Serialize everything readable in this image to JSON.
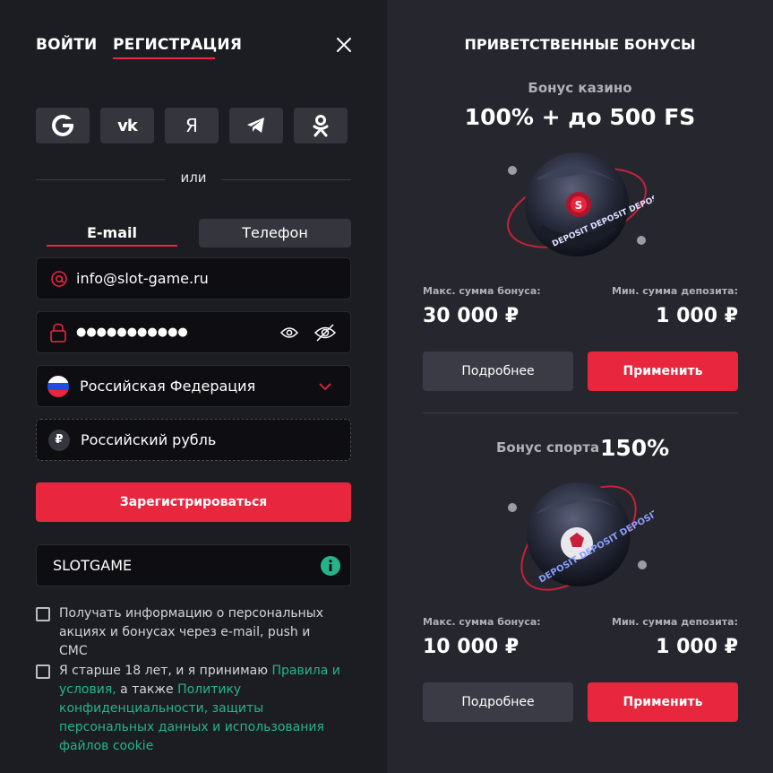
{
  "auth": {
    "tab_login": "ВОЙТИ",
    "tab_register": "РЕГИСТРАЦИЯ",
    "social": [
      {
        "name": "google",
        "glyph": "G"
      },
      {
        "name": "vk",
        "glyph": "vk"
      },
      {
        "name": "yandex",
        "glyph": "Я"
      },
      {
        "name": "telegram",
        "glyph": ""
      },
      {
        "name": "odnoklassniki",
        "glyph": ""
      }
    ],
    "or_text": "или",
    "method_email": "E-mail",
    "method_phone": "Телефон",
    "email_value": "info@slot-game.ru",
    "password_value": "●●●●●●●●●●●",
    "country_value": "Российская Федерация",
    "currency_value": "Российский рубль",
    "register_button": "Зарегистрироваться",
    "promo_value": "SLOTGAME",
    "consent_marketing": "Получать информацию о персональных акциях и бонусах через e-mail, push и СМС",
    "consent_age_prefix": "Я старше 18 лет, и я принимаю ",
    "consent_age_link1": "Правила и условия,",
    "consent_age_mid": " а также ",
    "consent_age_link2": "Политику конфиденциальности, защиты персональных данных и использования файлов cookie"
  },
  "bonuses": {
    "title": "ПРИВЕТСТВЕННЫЕ БОНУСЫ",
    "casino": {
      "label": "Бонус казино",
      "value": "100% + до 500 FS",
      "max_label": "Макс. сумма бонуса:",
      "max_value": "30 000 ₽",
      "min_label": "Мин. сумма депозита:",
      "min_value": "1 000 ₽",
      "more_button": "Подробнее",
      "apply_button": "Применить"
    },
    "sport": {
      "label": "Бонус спорта",
      "value": "150%",
      "max_label": "Макс. сумма бонуса:",
      "max_value": "10 000 ₽",
      "min_label": "Мин. сумма депозита:",
      "min_value": "1 000 ₽",
      "more_button": "Подробнее",
      "apply_button": "Применить"
    }
  },
  "colors": {
    "accent": "#e8263d",
    "link": "#26b38a",
    "panel_left": "#1c1d23",
    "panel_right": "#26272e"
  }
}
